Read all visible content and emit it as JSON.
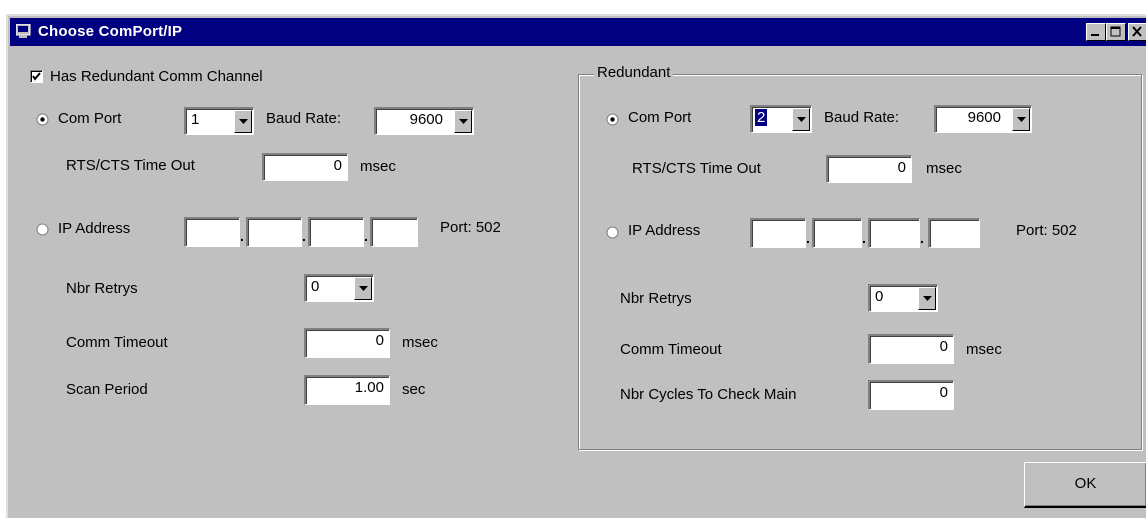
{
  "window": {
    "title": "Choose ComPort/IP"
  },
  "checkbox": {
    "label": "Has Redundant Comm Channel",
    "checked": true
  },
  "main": {
    "com_port_label": "Com Port",
    "com_port_value": "1",
    "baud_rate_label": "Baud Rate:",
    "baud_rate_value": "9600",
    "rts_label": "RTS/CTS Time Out",
    "rts_value": "0",
    "rts_unit": "msec",
    "ip_label": "IP Address",
    "port_label": "Port: 502",
    "nbr_retrys_label": "Nbr Retrys",
    "nbr_retrys_value": "0",
    "comm_timeout_label": "Comm Timeout",
    "comm_timeout_value": "0",
    "comm_timeout_unit": "msec",
    "scan_period_label": "Scan Period",
    "scan_period_value": "1.00",
    "scan_period_unit": "sec",
    "selected_mode": "Com Port"
  },
  "redundant": {
    "group_title": "Redundant",
    "com_port_label": "Com Port",
    "com_port_value": "2",
    "baud_rate_label": "Baud Rate:",
    "baud_rate_value": "9600",
    "rts_label": "RTS/CTS Time Out",
    "rts_value": "0",
    "rts_unit": "msec",
    "ip_label": "IP Address",
    "port_label": "Port: 502",
    "nbr_retrys_label": "Nbr Retrys",
    "nbr_retrys_value": "0",
    "comm_timeout_label": "Comm Timeout",
    "comm_timeout_value": "0",
    "comm_timeout_unit": "msec",
    "cycles_label": "Nbr Cycles To Check Main",
    "cycles_value": "0",
    "selected_mode": "Com Port"
  },
  "ok_label": "OK"
}
